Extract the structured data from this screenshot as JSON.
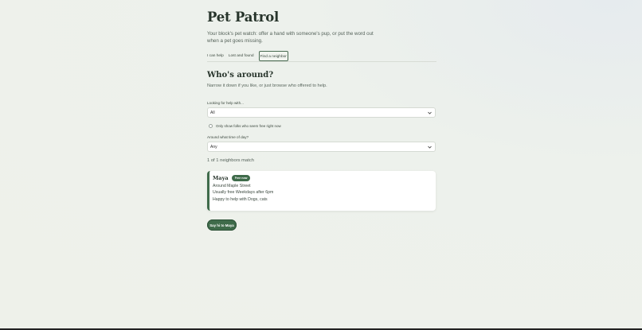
{
  "app": {
    "title": "Pet Patrol",
    "tagline": "Your block's pet watch: offer a hand with someone's pup, or put the word out when a pet goes missing."
  },
  "tabs": [
    {
      "label": "I can help",
      "active": false
    },
    {
      "label": "Lost and found",
      "active": false
    },
    {
      "label": "Find a neighbor",
      "active": true
    }
  ],
  "section": {
    "title": "Who's around?",
    "subtitle": "Narrow it down if you like, or just browse who offered to help."
  },
  "filters": {
    "help_label": "Looking for help with...",
    "help_value": "All",
    "free_now_label": "Only show folks who seem free right now",
    "free_now_checked": false,
    "time_label": "Around what time of day?",
    "time_value": "Any"
  },
  "results": {
    "count_text": "1 of 1 neighbors match",
    "cards": [
      {
        "name": "Maya",
        "badge": "Free now",
        "area": "Around Maple Street",
        "availability": "Usually free Weekdays after 6pm",
        "helps_with": "Happy to help with Dogs, cats"
      }
    ]
  },
  "actions": {
    "say_hi_label": "Say hi to Maya"
  },
  "colors": {
    "accent": "#3f6b4a",
    "title": "#27342b",
    "background": "#eef1ea"
  }
}
